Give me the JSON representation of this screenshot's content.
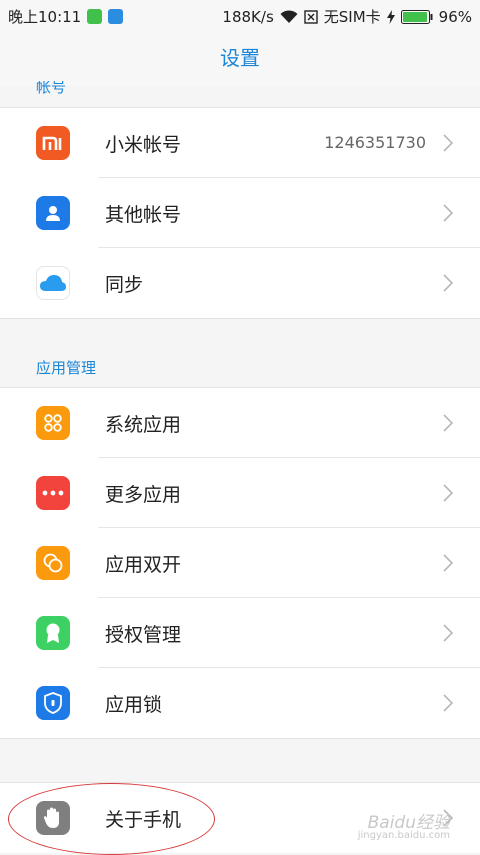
{
  "status_bar": {
    "time": "晚上10:11",
    "speed": "188K/s",
    "sim": "无SIM卡",
    "battery": "96%",
    "battery_level": 0.96
  },
  "title": "设置",
  "sections": {
    "account_header": "帐号",
    "app_mgmt_header": "应用管理"
  },
  "account_items": [
    {
      "label": "小米帐号",
      "value": "1246351730",
      "icon": "mi-logo-icon",
      "color": "#f15a22"
    },
    {
      "label": "其他帐号",
      "icon": "person-icon",
      "color": "#1e7ae6"
    },
    {
      "label": "同步",
      "icon": "cloud-icon",
      "color": "#ffffff"
    }
  ],
  "app_items": [
    {
      "label": "系统应用",
      "icon": "grid-icon",
      "color": "#fb9a0d"
    },
    {
      "label": "更多应用",
      "icon": "dots-icon",
      "color": "#f2443c"
    },
    {
      "label": "应用双开",
      "icon": "dual-circles-icon",
      "color": "#fb9a0d"
    },
    {
      "label": "授权管理",
      "icon": "award-icon",
      "color": "#3dd163"
    },
    {
      "label": "应用锁",
      "icon": "shield-lock-icon",
      "color": "#1e7ae6"
    }
  ],
  "about_item": {
    "label": "关于手机",
    "icon": "hand-icon",
    "color": "#7f7f7f"
  },
  "watermark": {
    "text": "Baidu经验",
    "sub": "jingyan.baidu.com"
  },
  "colors": {
    "accent": "#1a86d8"
  }
}
